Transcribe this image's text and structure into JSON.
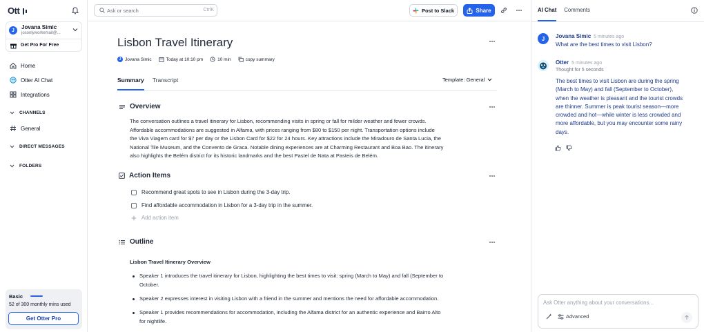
{
  "brand": {
    "logo_text": "Otter",
    "accent": "#2563eb"
  },
  "account": {
    "initial": "J",
    "name": "Jovana Simic",
    "email": "josonlyworkemail@...",
    "pro_label": "Get Pro For Free"
  },
  "nav": [
    {
      "label": "Home",
      "icon": "home-icon"
    },
    {
      "label": "Otter AI Chat",
      "icon": "otter-chat-icon"
    },
    {
      "label": "Integrations",
      "icon": "integrations-icon"
    }
  ],
  "sections": {
    "channels": "CHANNELS",
    "general": "General",
    "direct_messages": "DIRECT MESSAGES",
    "folders": "FOLDERS"
  },
  "usage": {
    "plan": "Basic",
    "used": 52,
    "total": 300,
    "mins_text": "52 of 300 monthly mins used",
    "cta": "Get Otter Pro"
  },
  "topbar": {
    "search_placeholder": "Ask or search",
    "search_shortcut": "CtrlK",
    "slack_label": "Post to Slack",
    "share_label": "Share"
  },
  "doc": {
    "title": "Lisbon Travel Itinerary",
    "author_initial": "J",
    "author": "Jovana Simic",
    "date": "Today at 10:10 pm",
    "duration": "10 min",
    "copy": "copy summary",
    "tabs": [
      "Summary",
      "Transcript"
    ],
    "template_label": "Template: General"
  },
  "overview": {
    "heading": "Overview",
    "lines": [
      "The conversation outlines a travel itinerary for Lisbon, recommending visits in spring or fall for milder weather and fewer crowds.",
      "Affordable accommodations are suggested in Alfama, with prices ranging from $80 to $150 per night. Transportation options include",
      "the Viva Viagem card for $7 per day or the Lisbon Card for $22 for 24 hours. Key attractions include the Miradouro de Santa Lucia, the",
      "National Tile Museum, and the Convento de Graca. Notable dining experiences are at Charming Restaurant and Boa Bao. The itinerary",
      "also highlights the Belém district for its historic landmarks and the best Pastel de Nata at Pasteis de Belém."
    ]
  },
  "action_items": {
    "heading": "Action Items",
    "items": [
      "Recommend great spots to see in Lisbon during the 3-day trip.",
      "Find affordable accommodation in Lisbon for a 3-day trip in the summer."
    ],
    "add_label": "Add action item"
  },
  "outline": {
    "heading": "Outline",
    "title": "Lisbon Travel Itinerary Overview",
    "bullets": [
      {
        "l1": "Speaker 1 introduces the travel itinerary for Lisbon, highlighting the best times to visit: spring (March to May) and fall (September to",
        "l2": "October."
      },
      {
        "l1": "Speaker 2 expresses interest in visiting Lisbon with a friend in the summer and mentions the need for affordable accommodation.",
        "l2": ""
      },
      {
        "l1": "Speaker 1 provides recommendations for accommodation, including the Alfama district for an authentic experience and Bairro Alto",
        "l2": "for nightlife."
      }
    ]
  },
  "right": {
    "tabs": [
      "AI Chat",
      "Comments"
    ],
    "user_msg": {
      "initial": "J",
      "name": "Jovana Simic",
      "time": "5 minutes ago",
      "text": "What are the best times to visit Lisbon?"
    },
    "otter_msg": {
      "name": "Otter",
      "time": "5 minutes ago",
      "thought": "Thought for 5 seconds",
      "lines": [
        "The best times to visit Lisbon are during the spring",
        "(March to May) and fall (September to October),",
        "when the weather is pleasant and the tourist crowds",
        "are thinner. Summer is peak tourist season—more",
        "crowded and hot—while winter is less crowded and",
        "more affordable, but you may encounter some rainy",
        "days."
      ]
    },
    "ask_placeholder": "Ask Otter anything about your conversations...",
    "advanced_label": "Advanced"
  }
}
